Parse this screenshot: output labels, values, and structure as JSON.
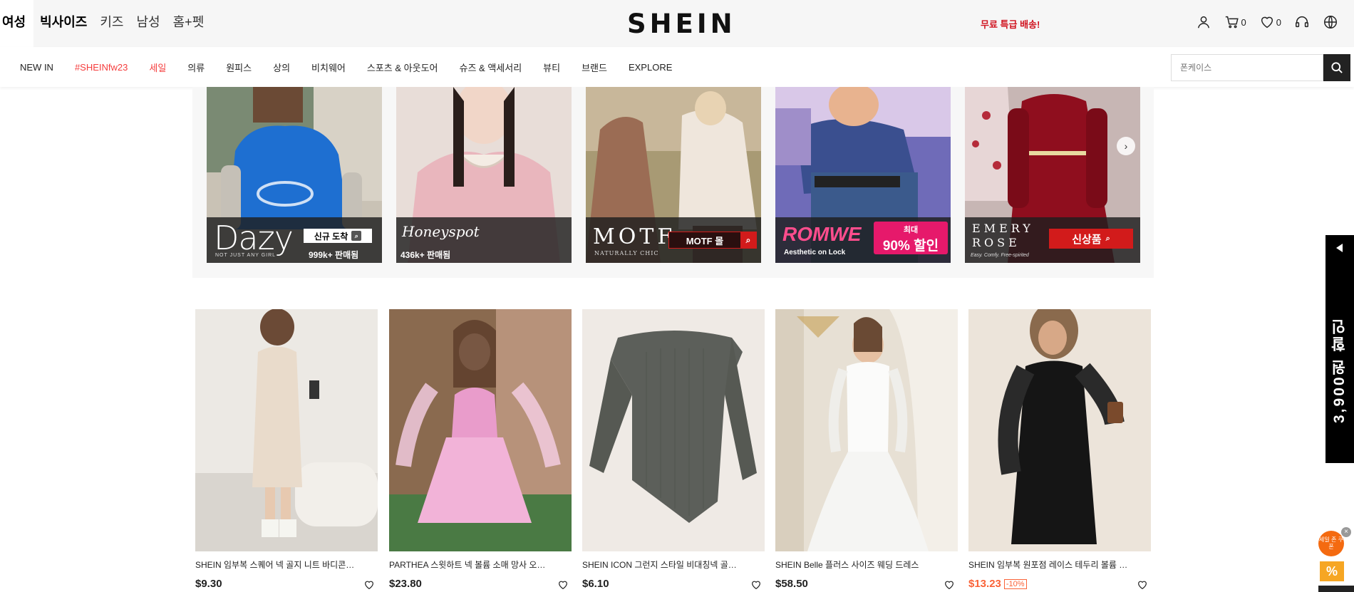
{
  "header": {
    "category_tabs": [
      {
        "label": "여성",
        "active": true
      },
      {
        "label": "빅사이즈",
        "bold": true
      },
      {
        "label": "키즈"
      },
      {
        "label": "남성"
      },
      {
        "label": "홈+펫"
      }
    ],
    "logo": "SHEIN",
    "promo_text": "무료 특급 배송!",
    "cart_count": "0",
    "wishlist_count": "0"
  },
  "nav": {
    "items": [
      {
        "label": "NEW IN",
        "red": false
      },
      {
        "label": "#SHEINfw23",
        "red": true
      },
      {
        "label": "세일",
        "red": true
      },
      {
        "label": "의류",
        "red": false
      },
      {
        "label": "원피스",
        "red": false
      },
      {
        "label": "상의",
        "red": false
      },
      {
        "label": "비치웨어",
        "red": false
      },
      {
        "label": "스포츠 & 아웃도어",
        "red": false
      },
      {
        "label": "슈즈 & 액세서리",
        "red": false
      },
      {
        "label": "뷰티",
        "red": false
      },
      {
        "label": "브랜드",
        "red": false
      },
      {
        "label": "EXPLORE",
        "red": false
      }
    ],
    "search_placeholder": "폰케이스"
  },
  "brands": [
    {
      "name": "Dazy",
      "tagline": "NOT JUST ANY GIRL",
      "cta": "신규 도착",
      "sold": "999k+ 판매됨"
    },
    {
      "name": "Honeyspot",
      "sold": "436k+ 판매됨"
    },
    {
      "name": "MOTF",
      "tagline": "NATURALLY CHIC",
      "cta": "MOTF 몰"
    },
    {
      "name": "ROMWE",
      "tagline": "Aesthetic on Lock",
      "cta_top": "최대",
      "cta": "90% 할인"
    },
    {
      "name": "EMERY ROSE",
      "tagline": "Easy. Comfy. Free-spirited",
      "cta": "신상품"
    }
  ],
  "products": [
    {
      "name": "SHEIN 임부복 스퀘어 넥 골지 니트 바디콘 드레스",
      "price": "$9.30",
      "sale": false,
      "discount": ""
    },
    {
      "name": "PARTHEA 스윗하트 넥 볼륨 소매 망사 오버레이 드레스",
      "price": "$23.80",
      "sale": false,
      "discount": ""
    },
    {
      "name": "SHEIN ICON 그런지 스타일 비대칭넥 골지 니트 탑",
      "price": "$6.10",
      "sale": false,
      "discount": ""
    },
    {
      "name": "SHEIN Belle 플러스 사이즈 웨딩 드레스",
      "price": "$58.50",
      "sale": false,
      "discount": ""
    },
    {
      "name": "SHEIN 임부복 원포점 레이스 테두리 볼륨 소매 드레스",
      "price": "$13.23",
      "sale": true,
      "discount": "-10%"
    }
  ],
  "side_promo": {
    "text": "3,900원 할인"
  },
  "coupon_badge": {
    "text": "세일 존\n쿠폰"
  },
  "percent_label": "%",
  "colors": {
    "accent_red": "#d0131f",
    "sale_orange": "#fa6338",
    "nav_red": "#f53d3d"
  }
}
